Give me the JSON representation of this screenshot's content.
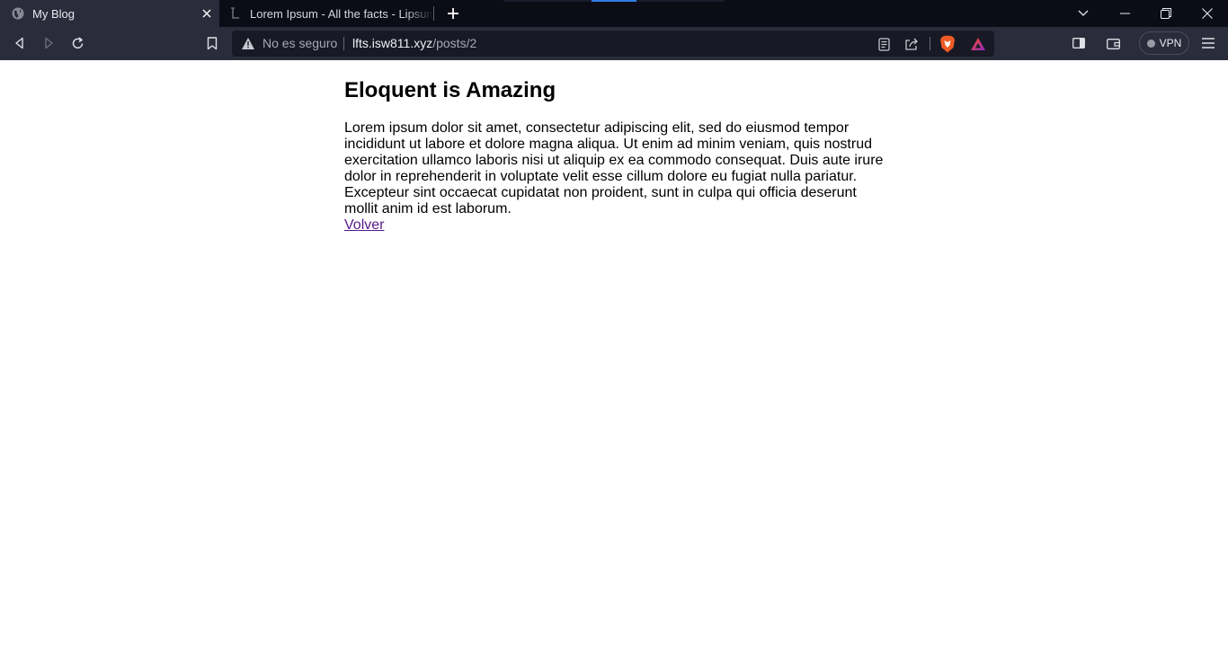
{
  "browser": {
    "tabs": [
      {
        "title": "My Blog",
        "active": true,
        "favicon": "globe-icon"
      },
      {
        "title": "Lorem Ipsum - All the facts - Lipsum generator",
        "active": false,
        "favicon": "lipsum-favicon"
      }
    ],
    "address_bar": {
      "security_label": "No es seguro",
      "host": "lfts.isw811.xyz",
      "path": "/posts/2"
    },
    "vpn_label": "VPN",
    "colors": {
      "tabstrip_bg": "#0c0c17",
      "toolbar_bg": "#2b2c3b",
      "urlbar_bg": "#181924",
      "accent_blue": "#2f7de1"
    }
  },
  "page": {
    "title": "Eloquent is Amazing",
    "body": "Lorem ipsum dolor sit amet, consectetur adipiscing elit, sed do eiusmod tempor incididunt ut labore et dolore magna aliqua. Ut enim ad minim veniam, quis nostrud exercitation ullamco laboris nisi ut aliquip ex ea commodo consequat. Duis aute irure dolor in reprehenderit in voluptate velit esse cillum dolore eu fugiat nulla pariatur. Excepteur sint occaecat cupidatat non proident, sunt in culpa qui officia deserunt mollit anim id est laborum.",
    "back_link": "Volver",
    "link_color": "#551a8b"
  }
}
